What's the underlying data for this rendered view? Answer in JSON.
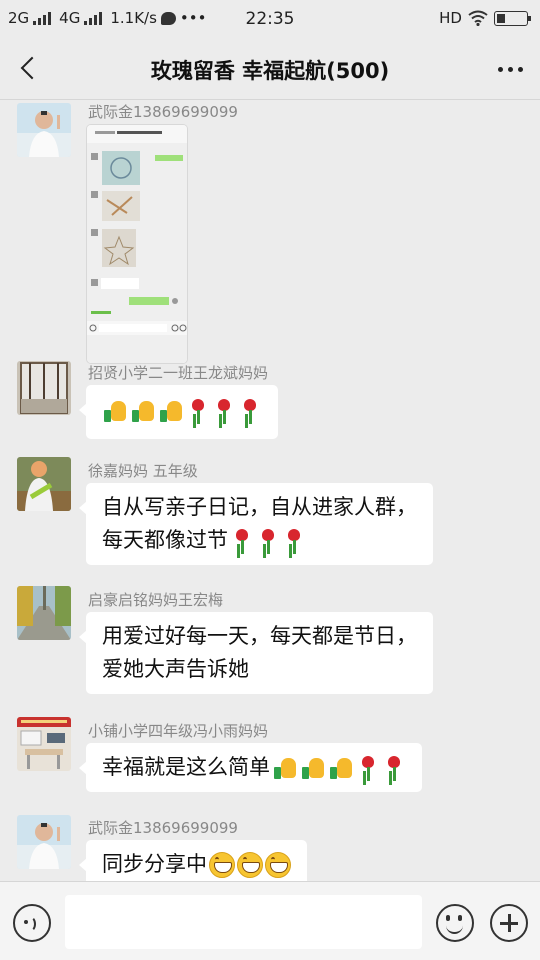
{
  "status_bar": {
    "network_2g": "2G",
    "network_4g": "4G",
    "speed": "1.1K/s",
    "more": "•••",
    "time": "22:35",
    "hd": "HD"
  },
  "header": {
    "title": "玫瑰留香  幸福起航(500)"
  },
  "messages": [
    {
      "sender": "武际金13869699099",
      "type": "image",
      "avatar": "man-white-shirt"
    },
    {
      "sender": "招贤小学二一班王龙斌妈妈",
      "type": "emoji",
      "content": [
        "thumbs-up",
        "thumbs-up",
        "thumbs-up",
        "rose",
        "rose",
        "rose"
      ],
      "avatar": "glass-door"
    },
    {
      "sender": "徐嘉妈妈 五年级",
      "type": "text",
      "lines": [
        "自从写亲子日记，自从进家人群，",
        "每天都像过节"
      ],
      "trailing_emoji": [
        "rose",
        "rose",
        "rose"
      ],
      "avatar": "woman-outdoors"
    },
    {
      "sender": "启豪启铭妈妈王宏梅",
      "type": "text",
      "lines": [
        "用爱过好每一天，每天都是节日，",
        "爱她大声告诉她"
      ],
      "avatar": "tree-lined-road"
    },
    {
      "sender": "小铺小学四年级冯小雨妈妈",
      "type": "text",
      "lines": [
        "幸福就是这么简单"
      ],
      "trailing_emoji": [
        "thumbs-up",
        "thumbs-up",
        "thumbs-up",
        "rose",
        "rose"
      ],
      "avatar": "classroom"
    },
    {
      "sender": "武际金13869699099",
      "type": "text",
      "lines": [
        "同步分享中"
      ],
      "trailing_emoji": [
        "grin",
        "grin",
        "grin"
      ],
      "avatar": "man-white-shirt"
    }
  ],
  "input_bar": {
    "voice_icon": "voice-icon",
    "emoji_icon": "emoji-icon",
    "plus_icon": "plus-icon",
    "placeholder": ""
  }
}
